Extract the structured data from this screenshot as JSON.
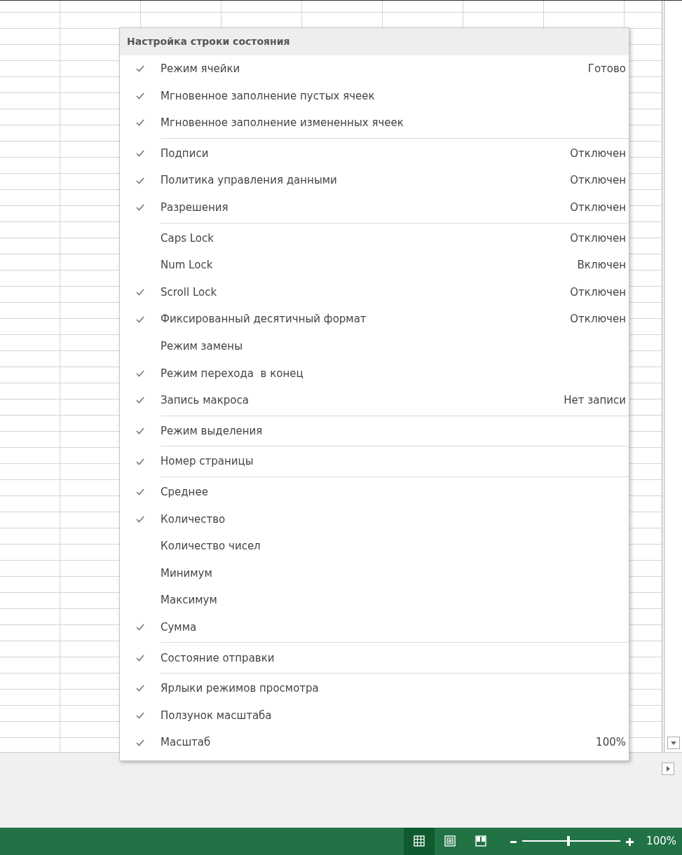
{
  "menu": {
    "title": "Настройка строки состояния",
    "groups": [
      [
        {
          "label": "Режим ячейки",
          "value": "Готово",
          "checked": true
        },
        {
          "label": "Мгновенное заполнение пустых ячеек",
          "checked": true
        },
        {
          "label": "Мгновенное заполнение измененных ячеек",
          "checked": true
        }
      ],
      [
        {
          "label": "Подписи",
          "value": "Отключен",
          "checked": true
        },
        {
          "label": "Политика управления данными",
          "value": "Отключен",
          "checked": true
        },
        {
          "label": "Разрешения",
          "value": "Отключен",
          "checked": true
        }
      ],
      [
        {
          "label": "Caps Lock",
          "value": "Отключен",
          "checked": false
        },
        {
          "label": "Num Lock",
          "value": "Включен",
          "checked": false
        },
        {
          "label": "Scroll Lock",
          "value": "Отключен",
          "checked": true
        },
        {
          "label": "Фиксированный десятичный формат",
          "value": "Отключен",
          "checked": true
        },
        {
          "label": "Режим замены",
          "checked": false
        },
        {
          "label": "Режим перехода  в конец",
          "checked": true
        },
        {
          "label": "Запись макроса",
          "value": "Нет записи",
          "checked": true
        }
      ],
      [
        {
          "label": "Режим выделения",
          "checked": true
        }
      ],
      [
        {
          "label": "Номер страницы",
          "checked": true
        }
      ],
      [
        {
          "label": "Среднее",
          "checked": true
        },
        {
          "label": "Количество",
          "checked": true
        },
        {
          "label": "Количество чисел",
          "checked": false
        },
        {
          "label": "Минимум",
          "checked": false
        },
        {
          "label": "Максимум",
          "checked": false
        },
        {
          "label": "Сумма",
          "checked": true
        }
      ],
      [
        {
          "label": "Состояние отправки",
          "checked": true
        }
      ],
      [
        {
          "label": "Ярлыки режимов просмотра",
          "checked": true
        },
        {
          "label": "Ползунок масштаба",
          "checked": true
        },
        {
          "label": "Масштаб",
          "value": "100%",
          "checked": true
        }
      ]
    ]
  },
  "status_bar": {
    "views": [
      {
        "kind": "normal",
        "selected": true
      },
      {
        "kind": "page_layout",
        "selected": false
      },
      {
        "kind": "page_break",
        "selected": false
      }
    ],
    "zoom_slider": {
      "level": 0.47
    },
    "zoom": "100%"
  }
}
